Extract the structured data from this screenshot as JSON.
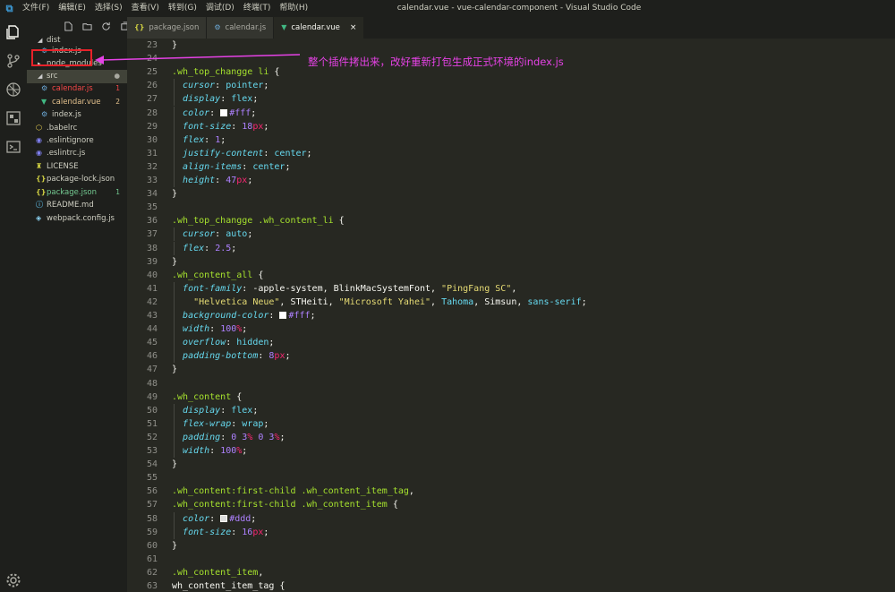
{
  "titlebar": {
    "menus": [
      "文件(F)",
      "编辑(E)",
      "选择(S)",
      "查看(V)",
      "转到(G)",
      "调试(D)",
      "终端(T)",
      "帮助(H)"
    ],
    "window_title": "calendar.vue - vue-calendar-component - Visual Studio Code"
  },
  "activity_icons": [
    "explorer-icon",
    "source-control-icon",
    "debug-icon",
    "extensions-icon",
    "terminal-icon",
    "settings-icon"
  ],
  "explorer": {
    "items": [
      {
        "label": "dist",
        "indent": 1,
        "type": "folder",
        "expanded": true
      },
      {
        "label": "index.js",
        "indent": 2,
        "icon": "js-gear-icon"
      },
      {
        "label": "node_modules",
        "indent": 1,
        "type": "folder",
        "expanded": false
      },
      {
        "label": "src",
        "indent": 1,
        "type": "folder",
        "expanded": true,
        "badge": "●"
      },
      {
        "label": "calendar.js",
        "indent": 2,
        "icon": "js-gear-icon",
        "badge": "1",
        "status": "error"
      },
      {
        "label": "calendar.vue",
        "indent": 2,
        "icon": "vue-icon",
        "badge": "2",
        "status": "warning"
      },
      {
        "label": "index.js",
        "indent": 2,
        "icon": "js-gear-icon"
      },
      {
        "label": ".babelrc",
        "indent": 1,
        "icon": "babel-icon"
      },
      {
        "label": ".eslintignore",
        "indent": 1,
        "icon": "eslint-icon"
      },
      {
        "label": ".eslintrc.js",
        "indent": 1,
        "icon": "eslint-icon"
      },
      {
        "label": "LICENSE",
        "indent": 1,
        "icon": "license-icon"
      },
      {
        "label": "package-lock.json",
        "indent": 1,
        "icon": "json-icon"
      },
      {
        "label": "package.json",
        "indent": 1,
        "icon": "json-icon",
        "badge": "1",
        "status": "modified"
      },
      {
        "label": "README.md",
        "indent": 1,
        "icon": "info-icon"
      },
      {
        "label": "webpack.config.js",
        "indent": 1,
        "icon": "webpack-icon"
      }
    ]
  },
  "tabs": [
    {
      "label": "package.json",
      "icon": "{}",
      "active": false
    },
    {
      "label": "calendar.js",
      "icon": "js-gear-icon",
      "active": false
    },
    {
      "label": "calendar.vue",
      "icon": "vue-icon",
      "active": true,
      "close": "×"
    }
  ],
  "annotation": "整个插件拷出来，改好重新打包生成正式环境的index.js",
  "code_lines": [
    {
      "n": "23",
      "tokens": [
        [
          "p",
          "}"
        ]
      ]
    },
    {
      "n": "24",
      "tokens": []
    },
    {
      "n": "25",
      "tokens": [
        [
          "sel",
          ".wh_top_changge li"
        ],
        [
          "p",
          " {"
        ]
      ]
    },
    {
      "n": "26",
      "tokens": [
        [
          "i",
          "  "
        ],
        [
          "prop",
          "cursor"
        ],
        [
          "p",
          ": "
        ],
        [
          "val",
          "pointer"
        ],
        [
          "p",
          ";"
        ]
      ]
    },
    {
      "n": "27",
      "tokens": [
        [
          "i",
          "  "
        ],
        [
          "prop",
          "display"
        ],
        [
          "p",
          ": "
        ],
        [
          "val",
          "flex"
        ],
        [
          "p",
          ";"
        ]
      ]
    },
    {
      "n": "28",
      "tokens": [
        [
          "i",
          "  "
        ],
        [
          "prop",
          "color"
        ],
        [
          "p",
          ": "
        ],
        [
          "sw",
          "#ffffff"
        ],
        [
          "num",
          "#fff"
        ],
        [
          "p",
          ";"
        ]
      ]
    },
    {
      "n": "29",
      "tokens": [
        [
          "i",
          "  "
        ],
        [
          "prop",
          "font-size"
        ],
        [
          "p",
          ": "
        ],
        [
          "num",
          "18"
        ],
        [
          "unit",
          "px"
        ],
        [
          "p",
          ";"
        ]
      ]
    },
    {
      "n": "30",
      "tokens": [
        [
          "i",
          "  "
        ],
        [
          "prop",
          "flex"
        ],
        [
          "p",
          ": "
        ],
        [
          "num",
          "1"
        ],
        [
          "p",
          ";"
        ]
      ]
    },
    {
      "n": "31",
      "tokens": [
        [
          "i",
          "  "
        ],
        [
          "prop",
          "justify-content"
        ],
        [
          "p",
          ": "
        ],
        [
          "val",
          "center"
        ],
        [
          "p",
          ";"
        ]
      ]
    },
    {
      "n": "32",
      "tokens": [
        [
          "i",
          "  "
        ],
        [
          "prop",
          "align-items"
        ],
        [
          "p",
          ": "
        ],
        [
          "val",
          "center"
        ],
        [
          "p",
          ";"
        ]
      ]
    },
    {
      "n": "33",
      "tokens": [
        [
          "i",
          "  "
        ],
        [
          "prop",
          "height"
        ],
        [
          "p",
          ": "
        ],
        [
          "num",
          "47"
        ],
        [
          "unit",
          "px"
        ],
        [
          "p",
          ";"
        ]
      ]
    },
    {
      "n": "34",
      "tokens": [
        [
          "p",
          "}"
        ]
      ]
    },
    {
      "n": "35",
      "tokens": []
    },
    {
      "n": "36",
      "tokens": [
        [
          "sel",
          ".wh_top_changge .wh_content_li"
        ],
        [
          "p",
          " {"
        ]
      ]
    },
    {
      "n": "37",
      "tokens": [
        [
          "i",
          "  "
        ],
        [
          "prop",
          "cursor"
        ],
        [
          "p",
          ": "
        ],
        [
          "val",
          "auto"
        ],
        [
          "p",
          ";"
        ]
      ]
    },
    {
      "n": "38",
      "tokens": [
        [
          "i",
          "  "
        ],
        [
          "prop",
          "flex"
        ],
        [
          "p",
          ": "
        ],
        [
          "num",
          "2.5"
        ],
        [
          "p",
          ";"
        ]
      ]
    },
    {
      "n": "39",
      "tokens": [
        [
          "p",
          "}"
        ]
      ]
    },
    {
      "n": "40",
      "tokens": [
        [
          "sel",
          ".wh_content_all"
        ],
        [
          "p",
          " {"
        ]
      ]
    },
    {
      "n": "41",
      "tokens": [
        [
          "i",
          "  "
        ],
        [
          "prop",
          "font-family"
        ],
        [
          "p",
          ": -apple-system, BlinkMacSystemFont, "
        ],
        [
          "str",
          "\"PingFang SC\""
        ],
        [
          "p",
          ","
        ]
      ]
    },
    {
      "n": "42",
      "tokens": [
        [
          "i",
          "    "
        ],
        [
          "str",
          "\"Helvetica Neue\""
        ],
        [
          "p",
          ", STHeiti, "
        ],
        [
          "str",
          "\"Microsoft Yahei\""
        ],
        [
          "p",
          ", "
        ],
        [
          "val",
          "Tahoma"
        ],
        [
          "p",
          ", Simsun, "
        ],
        [
          "val",
          "sans-serif"
        ],
        [
          "p",
          ";"
        ]
      ]
    },
    {
      "n": "43",
      "tokens": [
        [
          "i",
          "  "
        ],
        [
          "prop",
          "background-color"
        ],
        [
          "p",
          ": "
        ],
        [
          "sw",
          "#ffffff"
        ],
        [
          "num",
          "#fff"
        ],
        [
          "p",
          ";"
        ]
      ]
    },
    {
      "n": "44",
      "tokens": [
        [
          "i",
          "  "
        ],
        [
          "prop",
          "width"
        ],
        [
          "p",
          ": "
        ],
        [
          "num",
          "100"
        ],
        [
          "unit",
          "%"
        ],
        [
          "p",
          ";"
        ]
      ]
    },
    {
      "n": "45",
      "tokens": [
        [
          "i",
          "  "
        ],
        [
          "prop",
          "overflow"
        ],
        [
          "p",
          ": "
        ],
        [
          "val",
          "hidden"
        ],
        [
          "p",
          ";"
        ]
      ]
    },
    {
      "n": "46",
      "tokens": [
        [
          "i",
          "  "
        ],
        [
          "prop",
          "padding-bottom"
        ],
        [
          "p",
          ": "
        ],
        [
          "num",
          "8"
        ],
        [
          "unit",
          "px"
        ],
        [
          "p",
          ";"
        ]
      ]
    },
    {
      "n": "47",
      "tokens": [
        [
          "p",
          "}"
        ]
      ]
    },
    {
      "n": "48",
      "tokens": []
    },
    {
      "n": "49",
      "tokens": [
        [
          "sel",
          ".wh_content"
        ],
        [
          "p",
          " {"
        ]
      ]
    },
    {
      "n": "50",
      "tokens": [
        [
          "i",
          "  "
        ],
        [
          "prop",
          "display"
        ],
        [
          "p",
          ": "
        ],
        [
          "val",
          "flex"
        ],
        [
          "p",
          ";"
        ]
      ]
    },
    {
      "n": "51",
      "tokens": [
        [
          "i",
          "  "
        ],
        [
          "prop",
          "flex-wrap"
        ],
        [
          "p",
          ": "
        ],
        [
          "val",
          "wrap"
        ],
        [
          "p",
          ";"
        ]
      ]
    },
    {
      "n": "52",
      "tokens": [
        [
          "i",
          "  "
        ],
        [
          "prop",
          "padding"
        ],
        [
          "p",
          ": "
        ],
        [
          "num",
          "0 3"
        ],
        [
          "unit",
          "%"
        ],
        [
          "num",
          " 0 3"
        ],
        [
          "unit",
          "%"
        ],
        [
          "p",
          ";"
        ]
      ]
    },
    {
      "n": "53",
      "tokens": [
        [
          "i",
          "  "
        ],
        [
          "prop",
          "width"
        ],
        [
          "p",
          ": "
        ],
        [
          "num",
          "100"
        ],
        [
          "unit",
          "%"
        ],
        [
          "p",
          ";"
        ]
      ]
    },
    {
      "n": "54",
      "tokens": [
        [
          "p",
          "}"
        ]
      ]
    },
    {
      "n": "55",
      "tokens": []
    },
    {
      "n": "56",
      "tokens": [
        [
          "sel",
          ".wh_content:first-child .wh_content_item_tag"
        ],
        [
          "p",
          ","
        ]
      ]
    },
    {
      "n": "57",
      "tokens": [
        [
          "sel",
          ".wh_content:first-child .wh_content_item"
        ],
        [
          "p",
          " {"
        ]
      ]
    },
    {
      "n": "58",
      "tokens": [
        [
          "i",
          "  "
        ],
        [
          "prop",
          "color"
        ],
        [
          "p",
          ": "
        ],
        [
          "sw",
          "#dddddd"
        ],
        [
          "num",
          "#ddd"
        ],
        [
          "p",
          ";"
        ]
      ]
    },
    {
      "n": "59",
      "tokens": [
        [
          "i",
          "  "
        ],
        [
          "prop",
          "font-size"
        ],
        [
          "p",
          ": "
        ],
        [
          "num",
          "16"
        ],
        [
          "unit",
          "px"
        ],
        [
          "p",
          ";"
        ]
      ]
    },
    {
      "n": "60",
      "tokens": [
        [
          "p",
          "}"
        ]
      ]
    },
    {
      "n": "61",
      "tokens": []
    },
    {
      "n": "62",
      "tokens": [
        [
          "sel",
          ".wh_content_item"
        ],
        [
          "p",
          ","
        ]
      ]
    },
    {
      "n": "63",
      "tokens": [
        [
          "p",
          "wh_content_item_tag {"
        ]
      ]
    }
  ]
}
